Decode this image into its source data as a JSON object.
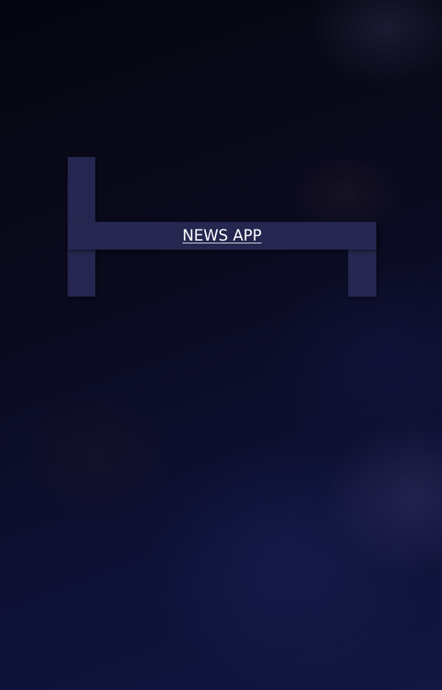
{
  "app": {
    "title": "NEWS APP"
  },
  "colors": {
    "background": "#08081a",
    "bracket": "#252750",
    "title_text": "#ffffff"
  }
}
